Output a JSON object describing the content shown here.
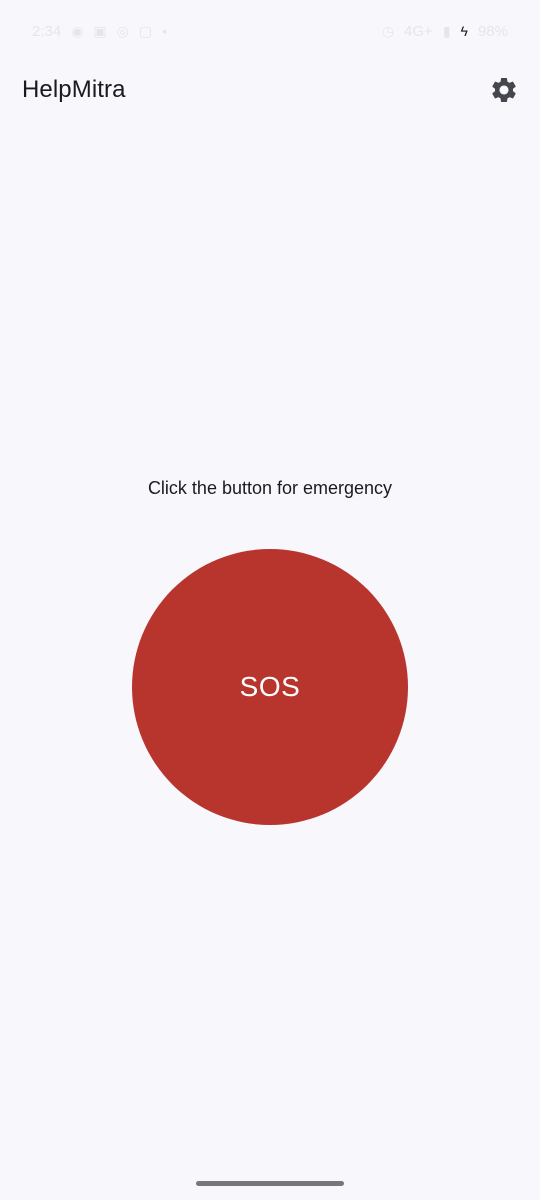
{
  "status_bar": {
    "time": "2:34",
    "battery": "98%",
    "network": "4G+"
  },
  "app_bar": {
    "title": "HelpMitra",
    "settings_icon": "gear-icon"
  },
  "main": {
    "instruction": "Click the button for emergency",
    "sos_label": "SOS"
  },
  "colors": {
    "background": "#F8F7FC",
    "sos_button": "#B8352E",
    "text": "#1B1B1F",
    "icon": "#44474E"
  }
}
